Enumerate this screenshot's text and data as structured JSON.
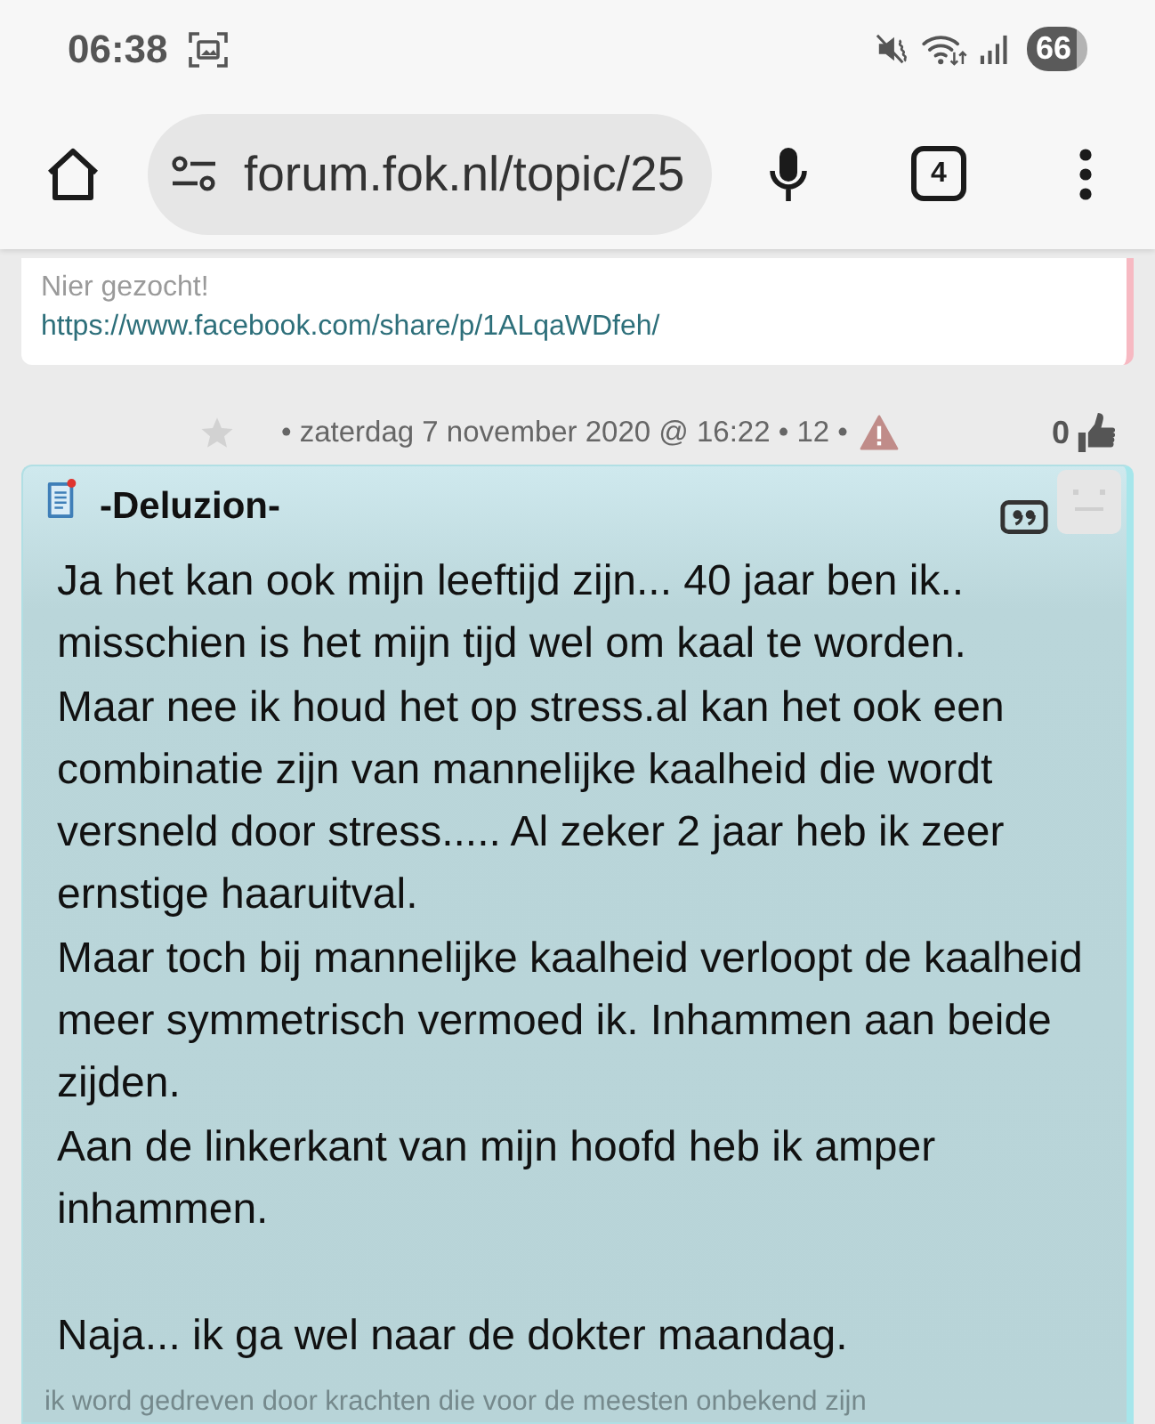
{
  "status_bar": {
    "time": "06:38",
    "battery": "66"
  },
  "browser": {
    "url": "forum.fok.nl/topic/25",
    "tab_count": "4"
  },
  "previous_post": {
    "signature": "Nier gezocht!",
    "link": "https://www.facebook.com/share/p/1ALqaWDfeh/"
  },
  "post_meta": {
    "date": "• zaterdag 7 november 2020 @ 16:22 • 12 •",
    "likes": "0"
  },
  "post": {
    "author": "-Deluzion-",
    "body": "Ja het kan ook mijn leeftijd zijn... 40 jaar ben ik.. misschien is het mijn tijd wel om kaal te worden.\nMaar nee ik houd het op stress.al kan het ook een combinatie zijn van mannelijke kaalheid die wordt versneld door stress..... Al zeker 2 jaar heb ik zeer ernstige haaruitval.\nMaar toch bij mannelijke kaalheid verloopt de kaalheid meer symmetrisch vermoed ik. Inhammen aan beide zijden.\nAan de linkerkant van mijn hoofd heb ik amper inhammen.\n\nNaja... ik ga wel naar de dokter maandag.",
    "signature": "ik word gedreven door krachten die voor de meesten onbekend zijn"
  }
}
